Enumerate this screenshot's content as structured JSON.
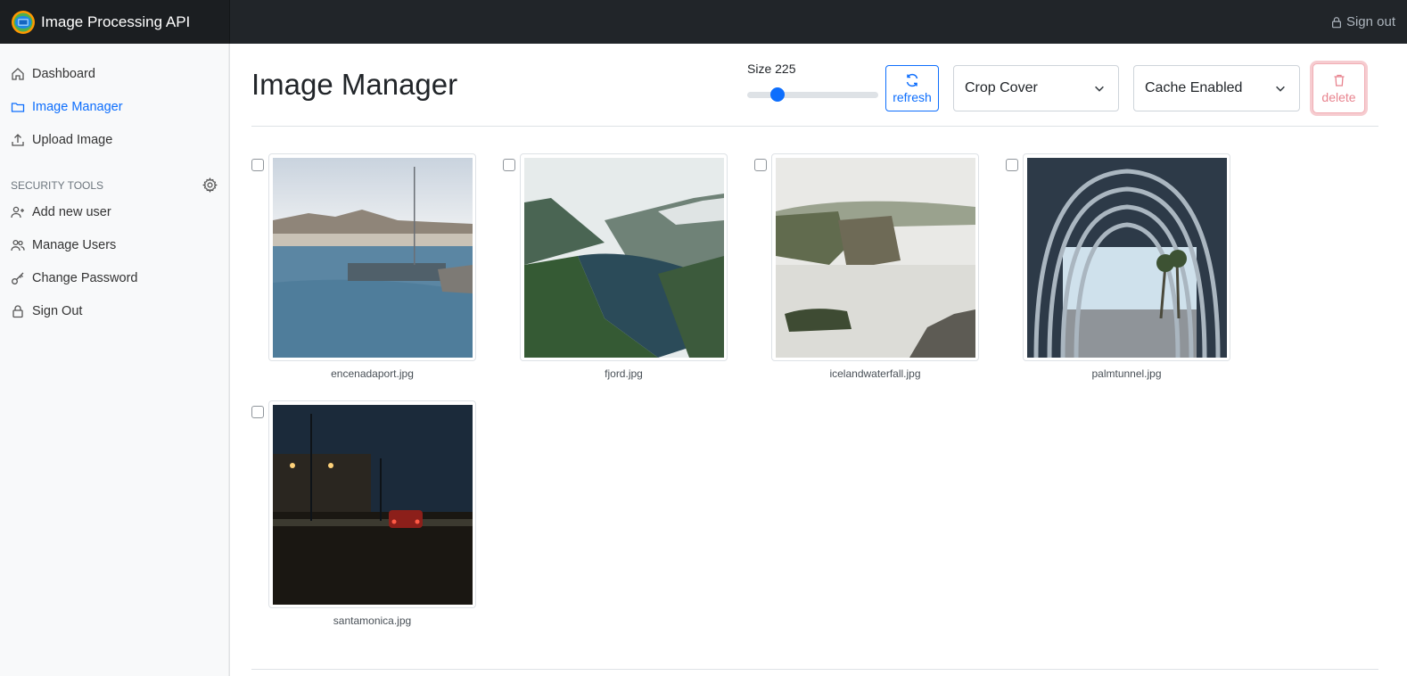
{
  "app": {
    "title": "Image Processing API",
    "signout_top": "Sign out"
  },
  "sidebar": {
    "items": [
      {
        "label": "Dashboard",
        "icon": "home-icon"
      },
      {
        "label": "Image Manager",
        "icon": "folder-icon",
        "active": true
      },
      {
        "label": "Upload Image",
        "icon": "upload-icon"
      }
    ],
    "security_heading": "SECURITY TOOLS",
    "security_items": [
      {
        "label": "Add new user",
        "icon": "user-plus-icon"
      },
      {
        "label": "Manage Users",
        "icon": "users-icon"
      },
      {
        "label": "Change Password",
        "icon": "key-icon"
      },
      {
        "label": "Sign Out",
        "icon": "lock-icon"
      }
    ]
  },
  "main": {
    "title": "Image Manager",
    "size_label": "Size 225",
    "size_slider": {
      "value": 225,
      "fraction": 0.2
    },
    "refresh_label": "refresh",
    "crop_select": "Crop Cover",
    "cache_select": "Cache Enabled",
    "delete_label": "delete"
  },
  "images": [
    {
      "filename": "encenadaport.jpg"
    },
    {
      "filename": "fjord.jpg"
    },
    {
      "filename": "icelandwaterfall.jpg"
    },
    {
      "filename": "palmtunnel.jpg"
    },
    {
      "filename": "santamonica.jpg"
    }
  ],
  "colors": {
    "accent": "#0d6efd",
    "navbar": "#212529",
    "danger": "#dc3545"
  }
}
